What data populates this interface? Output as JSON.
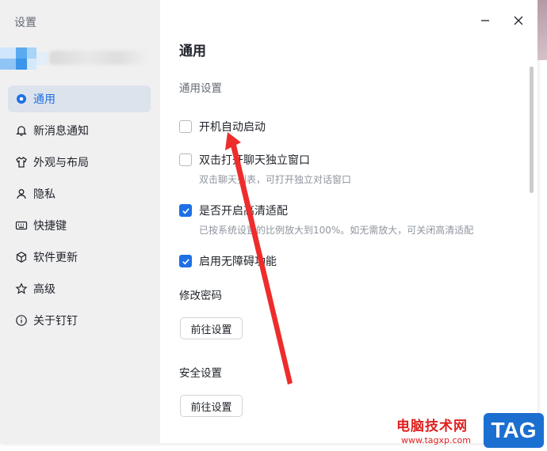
{
  "sidebar": {
    "title": "设置",
    "items": [
      {
        "label": "通用",
        "icon": "gear-icon",
        "active": true
      },
      {
        "label": "新消息通知",
        "icon": "bell-icon"
      },
      {
        "label": "外观与布局",
        "icon": "shirt-icon"
      },
      {
        "label": "隐私",
        "icon": "user-icon"
      },
      {
        "label": "快捷键",
        "icon": "keyboard-icon"
      },
      {
        "label": "软件更新",
        "icon": "cube-icon"
      },
      {
        "label": "高级",
        "icon": "star-icon"
      },
      {
        "label": "关于钉钉",
        "icon": "info-icon"
      }
    ]
  },
  "main": {
    "title": "通用",
    "general_section": "通用设置",
    "options": [
      {
        "label": "开机自动启动",
        "checked": false,
        "desc": ""
      },
      {
        "label": "双击打开聊天独立窗口",
        "checked": false,
        "desc": "双击聊天列表，可打开独立对话窗口"
      },
      {
        "label": "是否开启高清适配",
        "checked": true,
        "desc": "已按系统设置的比例放大到100%。如无需放大，可关闭高清适配"
      },
      {
        "label": "启用无障碍功能",
        "checked": true,
        "desc": ""
      }
    ],
    "password_section": "修改密码",
    "password_button": "前往设置",
    "security_section": "安全设置",
    "security_button": "前往设置"
  },
  "colors": {
    "accent": "#1f6fe5",
    "arrow": "#ee2c2c"
  },
  "watermark": {
    "text": "电脑技术网",
    "url": "www.tagxp.com",
    "badge": "TAG"
  }
}
